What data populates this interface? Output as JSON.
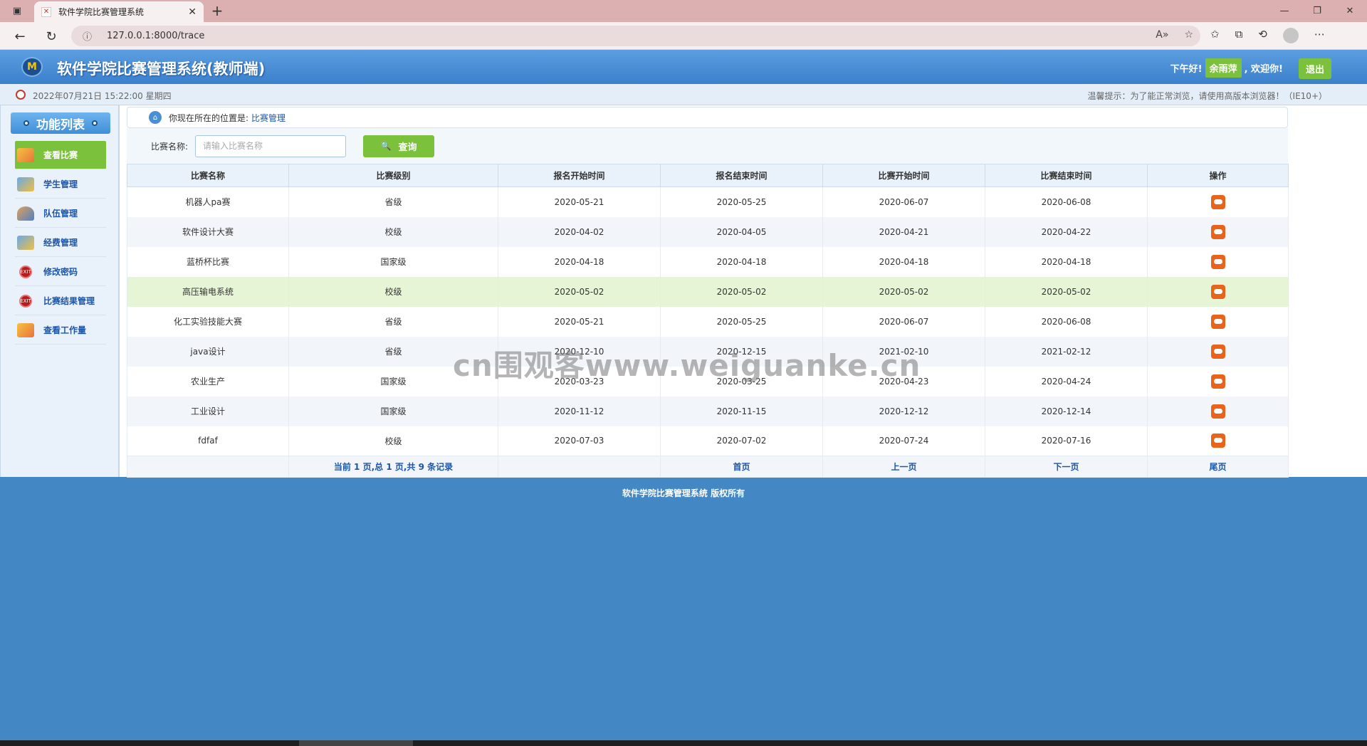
{
  "browser": {
    "tab_title": "软件学院比赛管理系统",
    "url": "127.0.0.1:8000/trace"
  },
  "header": {
    "title": "软件学院比赛管理系统(教师端)",
    "greeting": "下午好!",
    "username": "余雨萍",
    "welcome": ", 欢迎你!",
    "logout": "退出"
  },
  "status": {
    "datetime": "2022年07月21日 15:22:00 星期四",
    "tip": "温馨提示：为了能正常浏览，请使用高版本浏览器！（IE10+）"
  },
  "sidebar": {
    "title": "功能列表",
    "items": [
      {
        "label": "查看比赛",
        "icon": "contest-icon"
      },
      {
        "label": "学生管理",
        "icon": "student-icon"
      },
      {
        "label": "队伍管理",
        "icon": "team-icon"
      },
      {
        "label": "经费管理",
        "icon": "budget-icon"
      },
      {
        "label": "修改密码",
        "icon": "exit-icon"
      },
      {
        "label": "比赛结果管理",
        "icon": "exit-icon"
      },
      {
        "label": "查看工作量",
        "icon": "workload-icon"
      }
    ]
  },
  "breadcrumb": {
    "prefix": "你现在所在的位置是:",
    "current": "比赛管理"
  },
  "search": {
    "label": "比赛名称:",
    "placeholder": "请输入比赛名称",
    "button": "查询"
  },
  "table": {
    "columns": [
      "比赛名称",
      "比赛级别",
      "报名开始时间",
      "报名结束时间",
      "比赛开始时间",
      "比赛结束时间",
      "操作"
    ],
    "rows": [
      [
        "机器人pa赛",
        "省级",
        "2020-05-21",
        "2020-05-25",
        "2020-06-07",
        "2020-06-08"
      ],
      [
        "软件设计大赛",
        "校级",
        "2020-04-02",
        "2020-04-05",
        "2020-04-21",
        "2020-04-22"
      ],
      [
        "蓝桥杯比赛",
        "国家级",
        "2020-04-18",
        "2020-04-18",
        "2020-04-18",
        "2020-04-18"
      ],
      [
        "高压输电系统",
        "校级",
        "2020-05-02",
        "2020-05-02",
        "2020-05-02",
        "2020-05-02"
      ],
      [
        "化工实验技能大赛",
        "省级",
        "2020-05-21",
        "2020-05-25",
        "2020-06-07",
        "2020-06-08"
      ],
      [
        "java设计",
        "省级",
        "2020-12-10",
        "2020-12-15",
        "2021-02-10",
        "2021-02-12"
      ],
      [
        "农业生产",
        "国家级",
        "2020-03-23",
        "2020-03-25",
        "2020-04-23",
        "2020-04-24"
      ],
      [
        "工业设计",
        "国家级",
        "2020-11-12",
        "2020-11-15",
        "2020-12-12",
        "2020-12-14"
      ],
      [
        "fdfaf",
        "校级",
        "2020-07-03",
        "2020-07-02",
        "2020-07-24",
        "2020-07-16"
      ]
    ],
    "pager": {
      "info": "当前 1 页,总 1 页,共 9 条记录",
      "first": "首页",
      "prev": "上一页",
      "next": "下一页",
      "last": "尾页"
    }
  },
  "footer": "软件学院比赛管理系统 版权所有",
  "watermark": "cn围观客www.weiguanke.cn",
  "colors": {
    "header_blue": "#4387c4",
    "accent_green": "#7cc13b",
    "link_blue": "#1d56a8",
    "highlight_row": "#e7f5d7"
  }
}
